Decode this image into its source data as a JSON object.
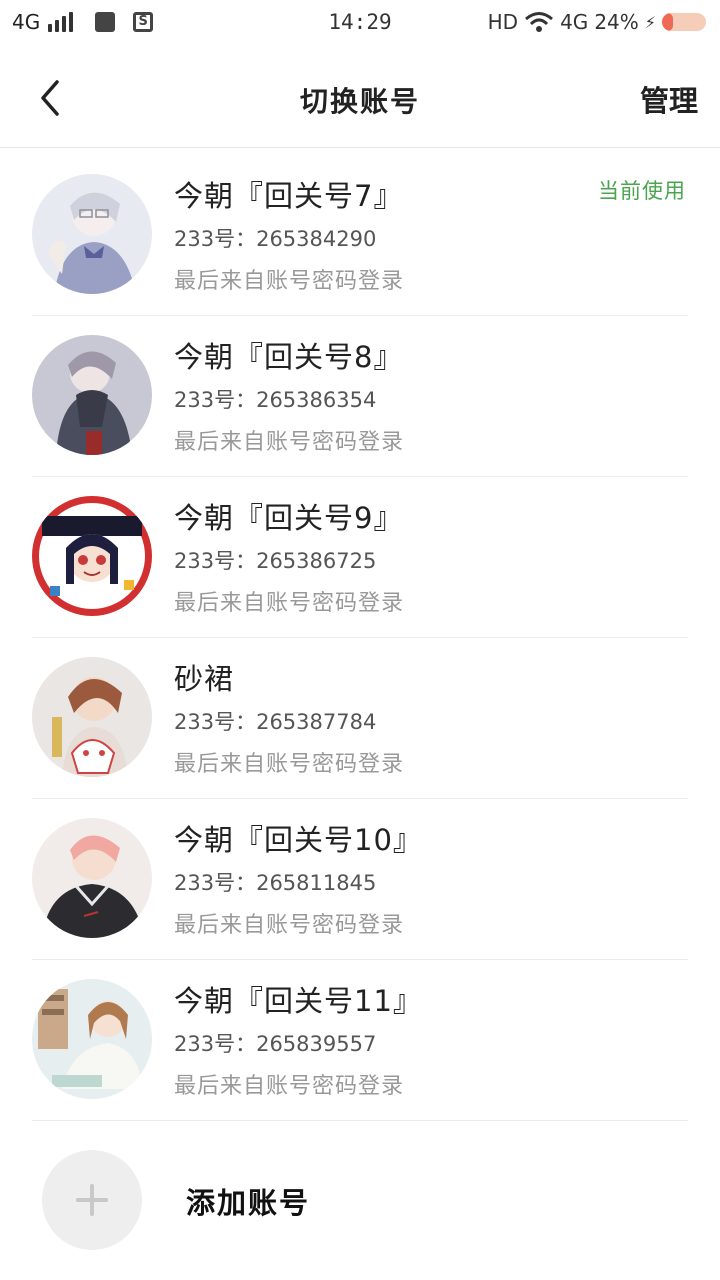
{
  "status_bar": {
    "network_left": "4G",
    "time": "14:29",
    "hd": "HD",
    "network_right": "4G",
    "battery": "24%",
    "battery_level": 0.24
  },
  "header": {
    "title": "切换账号",
    "manage_label": "管理"
  },
  "accounts": [
    {
      "name": "今朝『回关号7』",
      "id": "233号：265384290",
      "login": "最后来自账号密码登录",
      "current_tag": "当前使用"
    },
    {
      "name": "今朝『回关号8』",
      "id": "233号：265386354",
      "login": "最后来自账号密码登录"
    },
    {
      "name": "今朝『回关号9』",
      "id": "233号：265386725",
      "login": "最后来自账号密码登录"
    },
    {
      "name": "砂裙",
      "id": "233号：265387784",
      "login": "最后来自账号密码登录"
    },
    {
      "name": "今朝『回关号10』",
      "id": "233号：265811845",
      "login": "最后来自账号密码登录"
    },
    {
      "name": "今朝『回关号11』",
      "id": "233号：265839557",
      "login": "最后来自账号密码登录"
    }
  ],
  "add_account": {
    "label": "添加账号"
  },
  "colors": {
    "current_tag": "#4aa64e",
    "divider": "#ececec",
    "secondary_text": "#999999"
  }
}
